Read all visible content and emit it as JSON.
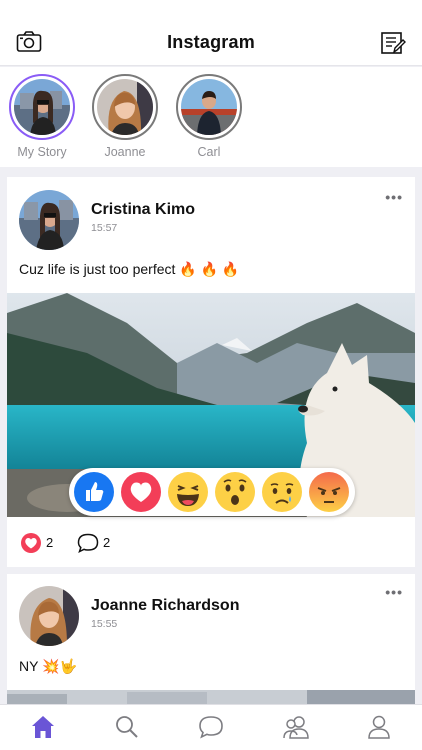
{
  "header": {
    "title": "Instagram",
    "camera_icon": "camera-icon",
    "compose_icon": "compose-icon"
  },
  "stories": [
    {
      "name": "My Story",
      "active": true
    },
    {
      "name": "Joanne",
      "active": false
    },
    {
      "name": "Carl",
      "active": false
    }
  ],
  "posts": [
    {
      "author": "Cristina Kimo",
      "time": "15:57",
      "text": "Cuz life is just too perfect 🔥 🔥 🔥",
      "likes": "2",
      "comments": "2"
    },
    {
      "author": "Joanne Richardson",
      "time": "15:55",
      "text": "NY 💥🤟"
    }
  ],
  "more_label": "•••",
  "reactions": [
    "like-reaction",
    "love-reaction",
    "haha-reaction",
    "wow-reaction",
    "sad-reaction",
    "angry-reaction"
  ],
  "colors": {
    "accent": "#6a55d6",
    "like": "#1877f2",
    "love": "#f33e58",
    "emoji": "#fdd046",
    "angry": "#f46a4b"
  },
  "tabs": [
    "home-icon",
    "search-icon",
    "chat-icon",
    "friends-icon",
    "profile-icon"
  ]
}
